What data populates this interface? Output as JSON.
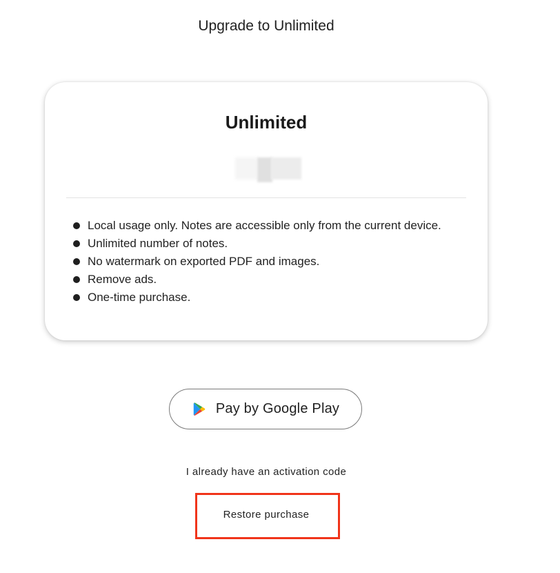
{
  "header": {
    "title": "Upgrade to Unlimited"
  },
  "plan": {
    "name": "Unlimited",
    "features": [
      "Local usage only. Notes are accessible only from the current device.",
      "Unlimited number of notes.",
      "No watermark on exported PDF and images.",
      "Remove ads.",
      "One-time purchase."
    ]
  },
  "actions": {
    "pay_label": "Pay by Google Play",
    "pay_icon": "google-play-icon",
    "activation_label": "I already have an activation code",
    "restore_label": "Restore purchase"
  },
  "colors": {
    "highlight": "#f0341a"
  }
}
